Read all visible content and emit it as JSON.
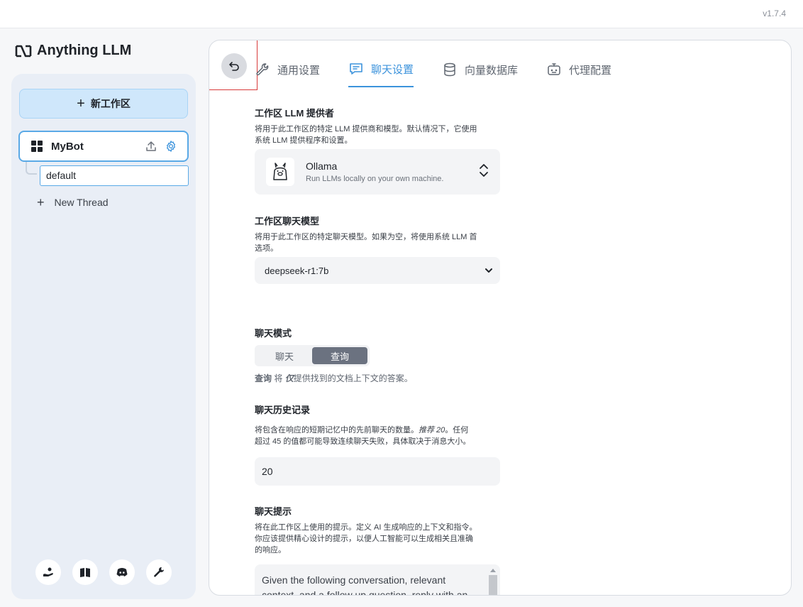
{
  "app": {
    "version": "v1.7.4",
    "logo_text": "Anything LLM"
  },
  "sidebar": {
    "new_workspace_label": "新工作区",
    "workspace": {
      "name": "MyBot"
    },
    "thread_default": "default",
    "new_thread_label": "New Thread",
    "footer_icons": [
      "community-hub-icon",
      "docs-book-icon",
      "discord-icon",
      "settings-wrench-icon"
    ]
  },
  "tabs": [
    {
      "label": "通用设置",
      "icon": "wrench-icon"
    },
    {
      "label": "聊天设置",
      "icon": "chat-icon",
      "active": true
    },
    {
      "label": "向量数据库",
      "icon": "database-icon"
    },
    {
      "label": "代理配置",
      "icon": "agent-icon"
    }
  ],
  "settings": {
    "llm_provider": {
      "title": "工作区 LLM 提供者",
      "desc_line1": "将用于此工作区的特定 LLM 提供商和模型。默认情况下，它使用",
      "desc_line2": "系统 LLM 提供程序和设置。",
      "provider_name": "Ollama",
      "provider_sub": "Run LLMs locally on your own machine."
    },
    "chat_model": {
      "title": "工作区聊天模型",
      "desc_line1": "将用于此工作区的特定聊天模型。如果为空，将使用系统 LLM 首",
      "desc_line2": "选项。",
      "selected": "deepseek-r1:7b"
    },
    "chat_mode": {
      "title": "聊天模式",
      "option_chat": "聊天",
      "option_query": "查询",
      "selected": "查询",
      "desc_bold": "查询",
      "desc_mid": " 将 ",
      "desc_italic": "仅",
      "desc_rest": "提供找到的文档上下文的答案。"
    },
    "chat_history": {
      "title": "聊天历史记录",
      "desc_line1_a": "将包含在响应的短期记忆中的先前聊天的数量。",
      "desc_line1_i": "推荐 20",
      "desc_line1_b": "。任何",
      "desc_line2": "超过 45 的值都可能导致连续聊天失败，具体取决于消息大小。",
      "value": "20"
    },
    "chat_prompt": {
      "title": "聊天提示",
      "desc_line1": "将在此工作区上使用的提示。定义 AI 生成响应的上下文和指令。",
      "desc_line2": "你应该提供精心设计的提示，以便人工智能可以生成相关且准确",
      "desc_line3": "的响应。",
      "value": "Given the following conversation, relevant context, and a follow up question, reply with an"
    }
  },
  "colors": {
    "accent": "#3c93dc",
    "highlight": "#d83a3a"
  }
}
